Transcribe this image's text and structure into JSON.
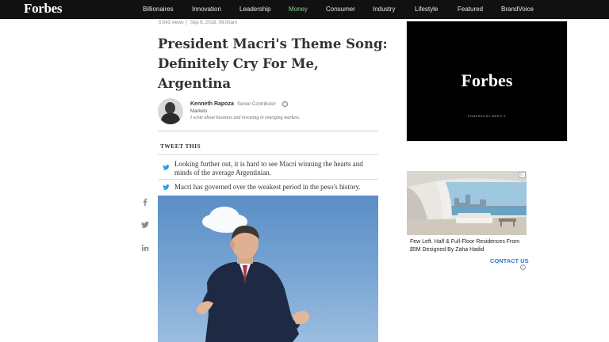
{
  "nav": {
    "logo": "Forbes",
    "items": [
      "Billionaires",
      "Innovation",
      "Leadership",
      "Money",
      "Consumer",
      "Industry",
      "Lifestyle",
      "Featured",
      "BrandVoice"
    ],
    "active_color": "#8fd48f"
  },
  "article": {
    "views": "5,543 views",
    "date": "Sep 6, 2018, 09:00am",
    "headline": "President Macri's Theme Song: Definitely Cry For Me, Argentina",
    "author": {
      "name": "Kenneth Rapoza",
      "role": "Senior Contributor",
      "section": "Markets",
      "bio": "I write about business and investing in emerging markets."
    },
    "tweet_this": {
      "title": "TWEET THIS",
      "items": [
        "Looking further out, it is hard to see Macri winning the hearts and minds of the average Argentinian.",
        "Macri has governed over the weakest period in the peso's history."
      ]
    }
  },
  "social": {
    "icons": [
      "facebook-icon",
      "twitter-icon",
      "linkedin-icon"
    ]
  },
  "ads": {
    "top": {
      "logo": "Forbes",
      "powered": "POWERED BY WEDIT Z"
    },
    "promo": {
      "headline": "Few Left. Half & Full-Floor Residences From $5M Designed By Zaha Hadid",
      "cta": "CONTACT US"
    }
  }
}
